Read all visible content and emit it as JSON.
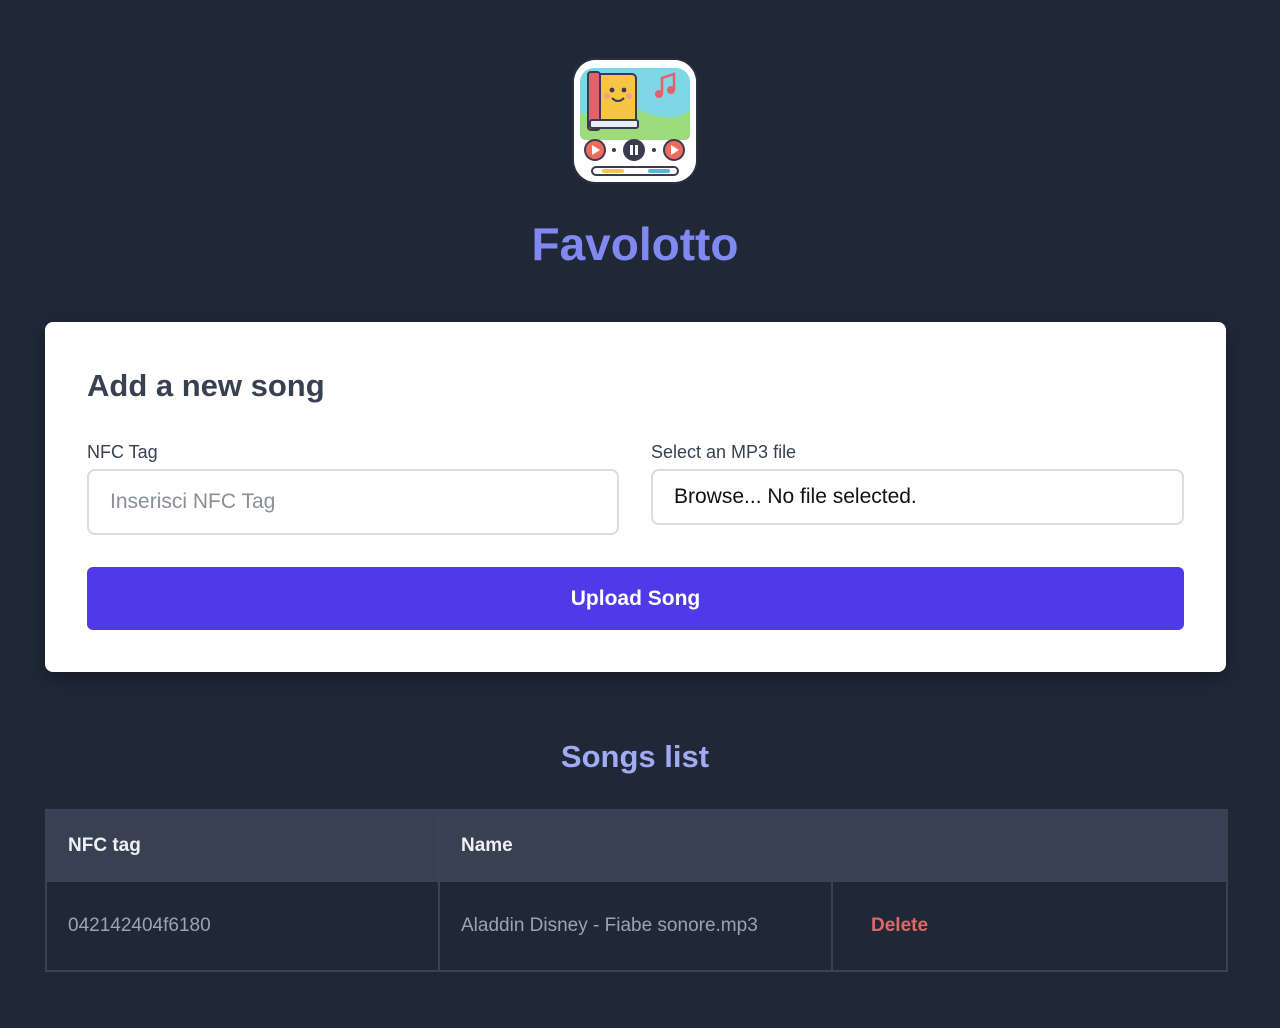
{
  "app": {
    "title": "Favolotto",
    "logo_icon": "storybook-music-player-icon"
  },
  "form": {
    "title": "Add a new song",
    "nfc_label": "NFC Tag",
    "nfc_placeholder": "Inserisci NFC Tag",
    "nfc_value": "",
    "file_label": "Select an MP3 file",
    "file_text": "Browse... No file selected.",
    "upload_label": "Upload Song"
  },
  "songs": {
    "title": "Songs list",
    "columns": [
      "NFC tag",
      "Name",
      ""
    ],
    "rows": [
      {
        "nfc_tag": "042142404f6180",
        "name": "Aladdin Disney - Fiabe sonore.mp3",
        "action": "Delete"
      }
    ]
  },
  "colors": {
    "background": "#202838",
    "accent": "#4f3aea",
    "title": "#8088f2",
    "delete": "#e06767"
  }
}
